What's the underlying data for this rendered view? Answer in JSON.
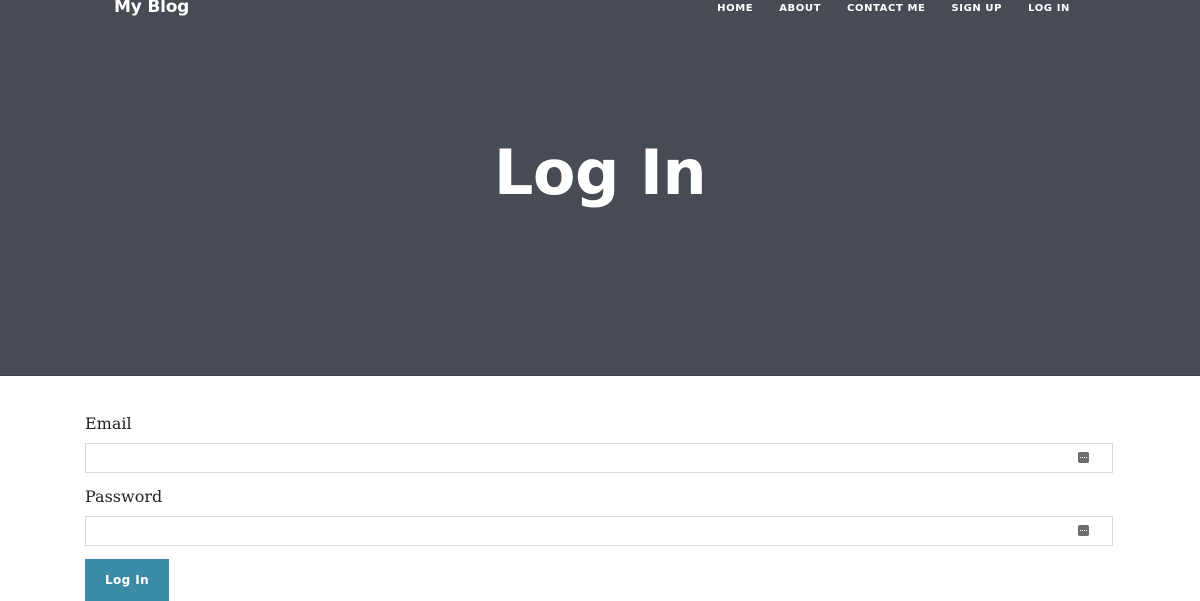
{
  "navbar": {
    "brand": "My Blog",
    "links": [
      "HOME",
      "ABOUT",
      "CONTACT ME",
      "SIGN UP",
      "LOG IN"
    ]
  },
  "hero": {
    "title": "Log In",
    "background_color": "#474c54"
  },
  "form": {
    "email": {
      "label": "Email",
      "value": "",
      "icon": "autofill-key-icon"
    },
    "password": {
      "label": "Password",
      "value": "",
      "icon": "autofill-key-icon"
    },
    "submit_label": "Log In",
    "submit_color": "#3b8aa6"
  }
}
